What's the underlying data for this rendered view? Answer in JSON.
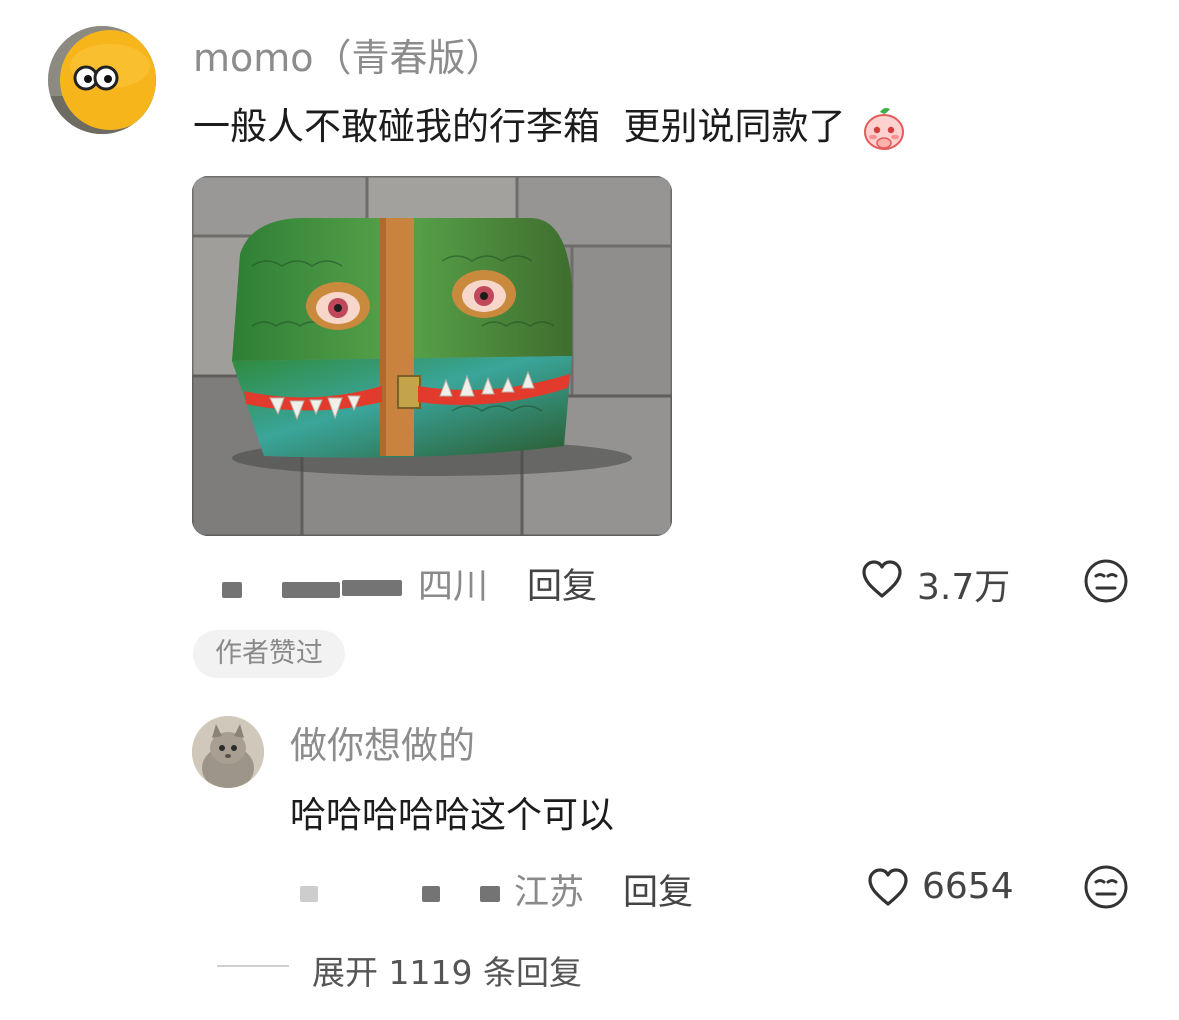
{
  "comment": {
    "username": "momo（青春版）",
    "text": "一般人不敢碰我的行李箱  更别说同款了",
    "emoji_icon": "shy-peach-emoji",
    "location": "四川",
    "reply_label": "回复",
    "likes": "3.7万",
    "author_liked_badge": "作者赞过"
  },
  "reply": {
    "username": "做你想做的",
    "text": "哈哈哈哈哈这个可以",
    "location": "江苏",
    "reply_label": "回复",
    "likes": "6654"
  },
  "expand": {
    "label": "展开 1119 条回复"
  },
  "icons": {
    "like": "heart-outline-icon",
    "dislike": "meh-face-icon"
  }
}
